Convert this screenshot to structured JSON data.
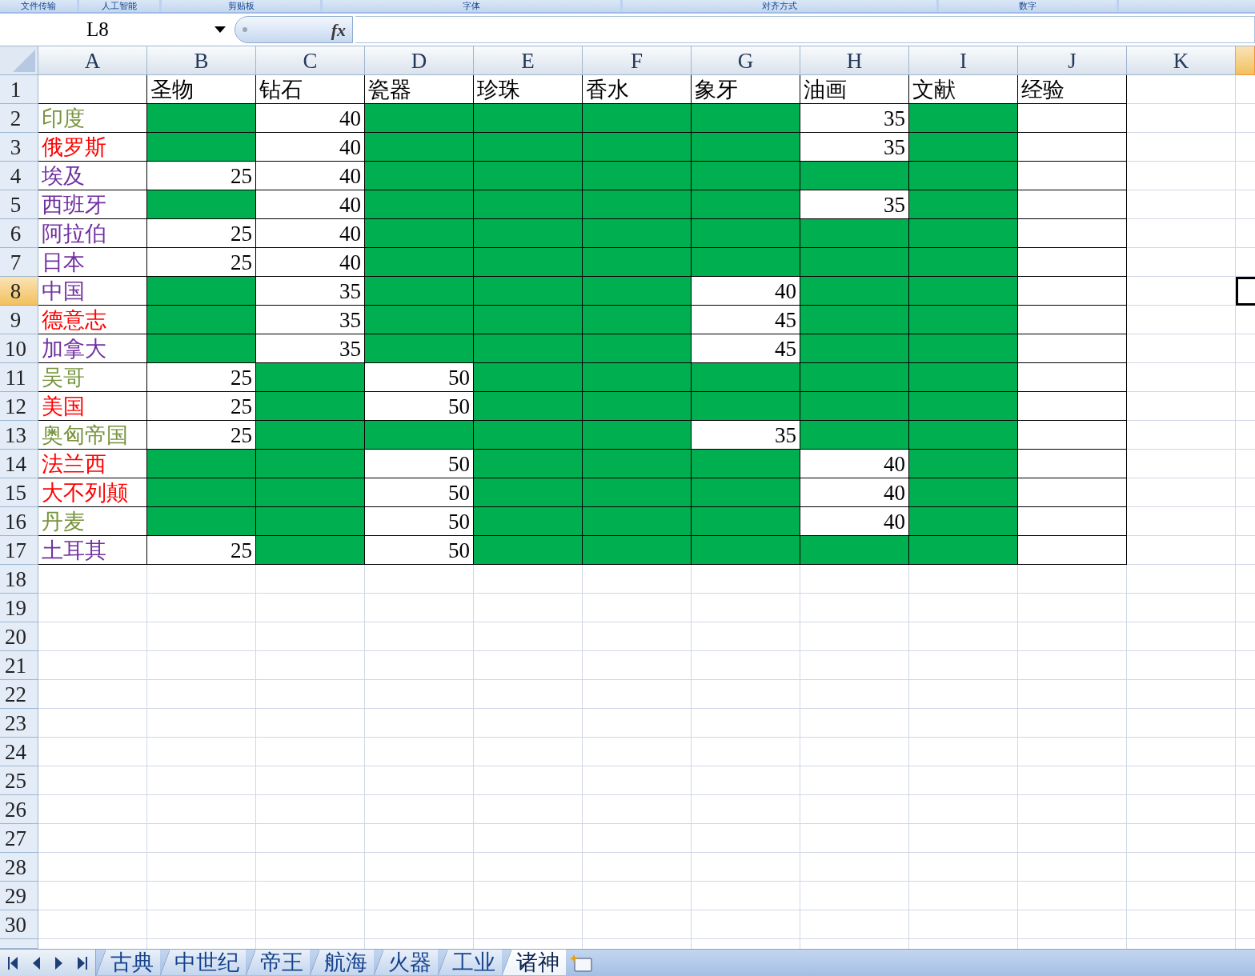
{
  "ribbon": {
    "groups": [
      "文件传输",
      "人工智能",
      "剪贴板",
      "字体",
      "对齐方式",
      "数字"
    ]
  },
  "formula_bar": {
    "name_box": "L8",
    "function_button": "fx"
  },
  "sheet": {
    "columns": [
      {
        "label": "A",
        "selected": false
      },
      {
        "label": "B",
        "selected": false
      },
      {
        "label": "C",
        "selected": false
      },
      {
        "label": "D",
        "selected": false
      },
      {
        "label": "E",
        "selected": false
      },
      {
        "label": "F",
        "selected": false
      },
      {
        "label": "G",
        "selected": false
      },
      {
        "label": "H",
        "selected": false
      },
      {
        "label": "I",
        "selected": false
      },
      {
        "label": "J",
        "selected": false
      },
      {
        "label": "K",
        "selected": false
      },
      {
        "selected": true
      }
    ],
    "row_headers": [
      {
        "label": "1",
        "selected": false
      },
      {
        "label": "2",
        "selected": false
      },
      {
        "label": "3",
        "selected": false
      },
      {
        "label": "4",
        "selected": false
      },
      {
        "label": "5",
        "selected": false
      },
      {
        "label": "6",
        "selected": false
      },
      {
        "label": "7",
        "selected": false
      },
      {
        "label": "8",
        "selected": true
      },
      {
        "label": "9",
        "selected": false
      },
      {
        "label": "10",
        "selected": false
      },
      {
        "label": "11",
        "selected": false
      },
      {
        "label": "12",
        "selected": false
      },
      {
        "label": "13",
        "selected": false
      },
      {
        "label": "14",
        "selected": false
      },
      {
        "label": "15",
        "selected": false
      },
      {
        "label": "16",
        "selected": false
      },
      {
        "label": "17",
        "selected": false
      },
      {
        "label": "18",
        "selected": false
      },
      {
        "label": "19",
        "selected": false
      },
      {
        "label": "20",
        "selected": false
      },
      {
        "label": "21",
        "selected": false
      },
      {
        "label": "22",
        "selected": false
      },
      {
        "label": "23",
        "selected": false
      },
      {
        "label": "24",
        "selected": false
      },
      {
        "label": "25",
        "selected": false
      },
      {
        "label": "26",
        "selected": false
      },
      {
        "label": "27",
        "selected": false
      },
      {
        "label": "28",
        "selected": false
      },
      {
        "label": "29",
        "selected": false
      },
      {
        "label": "30",
        "selected": false
      }
    ],
    "headings": [
      "圣物",
      "钻石",
      "瓷器",
      "珍珠",
      "香水",
      "象牙",
      "油画",
      "文献",
      "经验"
    ],
    "rows": [
      {
        "name": "印度",
        "color": "#77933c",
        "cells": [
          {
            "color": "#00b050"
          },
          {
            "text": "40"
          },
          {
            "color": "#00b050"
          },
          {
            "color": "#00b050"
          },
          {
            "color": "#00b050"
          },
          {
            "color": "#00b050"
          },
          {
            "text": "35"
          },
          {
            "color": "#00b050"
          }
        ]
      },
      {
        "name": "俄罗斯",
        "color": "#ff0000",
        "cells": [
          {
            "color": "#00b050"
          },
          {
            "text": "40"
          },
          {
            "color": "#00b050"
          },
          {
            "color": "#00b050"
          },
          {
            "color": "#00b050"
          },
          {
            "color": "#00b050"
          },
          {
            "text": "35"
          },
          {
            "color": "#00b050"
          }
        ]
      },
      {
        "name": "埃及",
        "color": "#7030a0",
        "cells": [
          {
            "text": "25"
          },
          {
            "text": "40"
          },
          {
            "color": "#00b050"
          },
          {
            "color": "#00b050"
          },
          {
            "color": "#00b050"
          },
          {
            "color": "#00b050"
          },
          {
            "color": "#00b050"
          },
          {
            "color": "#00b050"
          }
        ]
      },
      {
        "name": "西班牙",
        "color": "#7030a0",
        "cells": [
          {
            "color": "#00b050"
          },
          {
            "text": "40"
          },
          {
            "color": "#00b050"
          },
          {
            "color": "#00b050"
          },
          {
            "color": "#00b050"
          },
          {
            "color": "#00b050"
          },
          {
            "text": "35"
          },
          {
            "color": "#00b050"
          }
        ]
      },
      {
        "name": "阿拉伯",
        "color": "#7030a0",
        "cells": [
          {
            "text": "25"
          },
          {
            "text": "40"
          },
          {
            "color": "#00b050"
          },
          {
            "color": "#00b050"
          },
          {
            "color": "#00b050"
          },
          {
            "color": "#00b050"
          },
          {
            "color": "#00b050"
          },
          {
            "color": "#00b050"
          }
        ]
      },
      {
        "name": "日本",
        "color": "#7030a0",
        "cells": [
          {
            "text": "25"
          },
          {
            "text": "40"
          },
          {
            "color": "#00b050"
          },
          {
            "color": "#00b050"
          },
          {
            "color": "#00b050"
          },
          {
            "color": "#00b050"
          },
          {
            "color": "#00b050"
          },
          {
            "color": "#00b050"
          }
        ]
      },
      {
        "name": "中国",
        "color": "#7030a0",
        "cells": [
          {
            "color": "#00b050"
          },
          {
            "text": "35"
          },
          {
            "color": "#00b050"
          },
          {
            "color": "#00b050"
          },
          {
            "color": "#00b050"
          },
          {
            "text": "40"
          },
          {
            "color": "#00b050"
          },
          {
            "color": "#00b050"
          }
        ]
      },
      {
        "name": "德意志",
        "color": "#ff0000",
        "cells": [
          {
            "color": "#00b050"
          },
          {
            "text": "35"
          },
          {
            "color": "#00b050"
          },
          {
            "color": "#00b050"
          },
          {
            "color": "#00b050"
          },
          {
            "text": "45"
          },
          {
            "color": "#00b050"
          },
          {
            "color": "#00b050"
          }
        ]
      },
      {
        "name": "加拿大",
        "color": "#7030a0",
        "cells": [
          {
            "color": "#00b050"
          },
          {
            "text": "35"
          },
          {
            "color": "#00b050"
          },
          {
            "color": "#00b050"
          },
          {
            "color": "#00b050"
          },
          {
            "text": "45"
          },
          {
            "color": "#00b050"
          },
          {
            "color": "#00b050"
          }
        ]
      },
      {
        "name": "吴哥",
        "color": "#77933c",
        "cells": [
          {
            "text": "25"
          },
          {
            "color": "#00b050"
          },
          {
            "text": "50"
          },
          {
            "color": "#00b050"
          },
          {
            "color": "#00b050"
          },
          {
            "color": "#00b050"
          },
          {
            "color": "#00b050"
          },
          {
            "color": "#00b050"
          }
        ]
      },
      {
        "name": "美国",
        "color": "#ff0000",
        "cells": [
          {
            "text": "25"
          },
          {
            "color": "#00b050"
          },
          {
            "text": "50"
          },
          {
            "color": "#00b050"
          },
          {
            "color": "#00b050"
          },
          {
            "color": "#00b050"
          },
          {
            "color": "#00b050"
          },
          {
            "color": "#00b050"
          }
        ]
      },
      {
        "name": "奥匈帝国",
        "color": "#77933c",
        "cells": [
          {
            "text": "25"
          },
          {
            "color": "#00b050"
          },
          {
            "color": "#00b050"
          },
          {
            "color": "#00b050"
          },
          {
            "color": "#00b050"
          },
          {
            "text": "35"
          },
          {
            "color": "#00b050"
          },
          {
            "color": "#00b050"
          }
        ]
      },
      {
        "name": "法兰西",
        "color": "#ff0000",
        "cells": [
          {
            "color": "#00b050"
          },
          {
            "color": "#00b050"
          },
          {
            "text": "50"
          },
          {
            "color": "#00b050"
          },
          {
            "color": "#00b050"
          },
          {
            "color": "#00b050"
          },
          {
            "text": "40"
          },
          {
            "color": "#00b050"
          }
        ]
      },
      {
        "name": "大不列颠",
        "color": "#ff0000",
        "cells": [
          {
            "color": "#00b050"
          },
          {
            "color": "#00b050"
          },
          {
            "text": "50"
          },
          {
            "color": "#00b050"
          },
          {
            "color": "#00b050"
          },
          {
            "color": "#00b050"
          },
          {
            "text": "40"
          },
          {
            "color": "#00b050"
          }
        ]
      },
      {
        "name": "丹麦",
        "color": "#77933c",
        "cells": [
          {
            "color": "#00b050"
          },
          {
            "color": "#00b050"
          },
          {
            "text": "50"
          },
          {
            "color": "#00b050"
          },
          {
            "color": "#00b050"
          },
          {
            "color": "#00b050"
          },
          {
            "text": "40"
          },
          {
            "color": "#00b050"
          }
        ]
      },
      {
        "name": "土耳其",
        "color": "#7030a0",
        "cells": [
          {
            "text": "25"
          },
          {
            "color": "#00b050"
          },
          {
            "text": "50"
          },
          {
            "color": "#00b050"
          },
          {
            "color": "#00b050"
          },
          {
            "color": "#00b050"
          },
          {
            "color": "#00b050"
          },
          {
            "color": "#00b050"
          }
        ]
      }
    ]
  },
  "sheet_tabs": [
    {
      "label": "古典",
      "selected": false
    },
    {
      "label": "中世纪",
      "selected": false
    },
    {
      "label": "帝王",
      "selected": false
    },
    {
      "label": "航海",
      "selected": false
    },
    {
      "label": "火器",
      "selected": false
    },
    {
      "label": "工业",
      "selected": false
    },
    {
      "label": "诸神",
      "selected": true
    }
  ]
}
